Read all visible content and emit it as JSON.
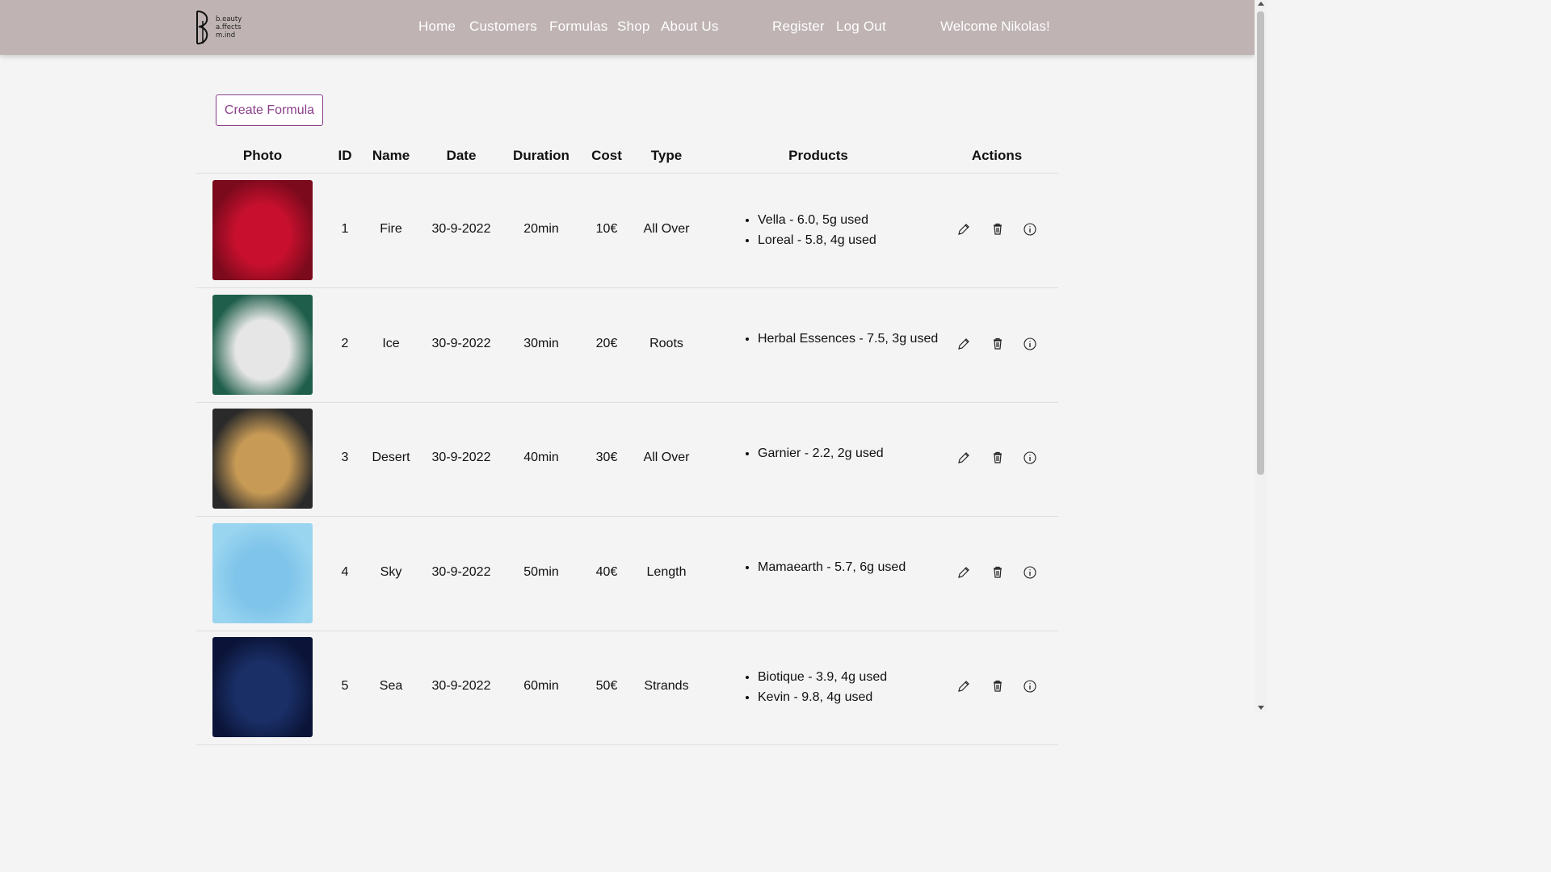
{
  "brand": {
    "logo_lines": [
      "b.eauty",
      "a.ffects",
      "m.ind"
    ]
  },
  "nav": {
    "home": "Home",
    "customers": "Customers",
    "formulas": "Formulas",
    "shop": "Shop",
    "about": "About Us",
    "register": "Register",
    "logout": "Log Out",
    "welcome": "Welcome Nikolas!"
  },
  "create_button": "Create Formula",
  "table": {
    "headers": {
      "photo": "Photo",
      "id": "ID",
      "name": "Name",
      "date": "Date",
      "duration": "Duration",
      "cost": "Cost",
      "type": "Type",
      "products": "Products",
      "actions": "Actions"
    },
    "rows": [
      {
        "id": "1",
        "name": "Fire",
        "date": "30-9-2022",
        "duration": "20min",
        "cost": "10€",
        "type": "All Over",
        "products": [
          "Vella - 6.0, 5g used",
          "Loreal - 5.8, 4g used"
        ]
      },
      {
        "id": "2",
        "name": "Ice",
        "date": "30-9-2022",
        "duration": "30min",
        "cost": "20€",
        "type": "Roots",
        "products": [
          "Herbal Essences - 7.5, 3g used"
        ]
      },
      {
        "id": "3",
        "name": "Desert",
        "date": "30-9-2022",
        "duration": "40min",
        "cost": "30€",
        "type": "All Over",
        "products": [
          "Garnier - 2.2, 2g used"
        ]
      },
      {
        "id": "4",
        "name": "Sky",
        "date": "30-9-2022",
        "duration": "50min",
        "cost": "40€",
        "type": "Length",
        "products": [
          "Mamaearth - 5.7, 6g used"
        ]
      },
      {
        "id": "5",
        "name": "Sea",
        "date": "30-9-2022",
        "duration": "60min",
        "cost": "50€",
        "type": "Strands",
        "products": [
          "Biotique - 3.9, 4g used",
          "Kevin - 9.8, 4g used"
        ]
      }
    ]
  },
  "colors": {
    "navbar": "#bfb3b3",
    "accent": "#8a3f8a",
    "background": "#f4f4f4",
    "photo_gradients": [
      [
        "#f0f0f0",
        "#c8102e",
        "#7a0a1c"
      ],
      [
        "#6fa7c7",
        "#e6e6e6",
        "#1f5e4a"
      ],
      [
        "#d9d9d9",
        "#c79a55",
        "#2a2a2a"
      ],
      [
        "#e0e8f0",
        "#7fc4ea",
        "#9ad5f0"
      ],
      [
        "#d9dde3",
        "#1a2f66",
        "#0b1438"
      ]
    ]
  },
  "icons": {
    "edit": "pencil-icon",
    "delete": "trash-icon",
    "info": "info-icon"
  }
}
